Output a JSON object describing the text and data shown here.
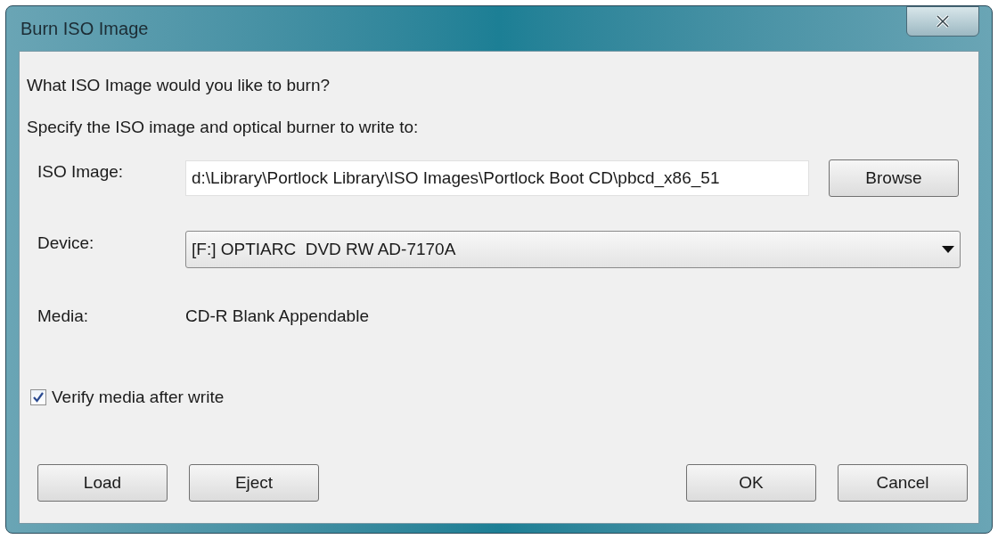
{
  "window": {
    "title": "Burn ISO Image"
  },
  "heading": "What ISO Image would you like to burn?",
  "instruction": "Specify the ISO image and optical burner to write to:",
  "iso_image": {
    "label": "ISO Image:",
    "value": "d:\\Library\\Portlock Library\\ISO Images\\Portlock Boot CD\\pbcd_x86_51",
    "browse": "Browse"
  },
  "device": {
    "label": "Device:",
    "value": "[F:] OPTIARC  DVD RW AD-7170A"
  },
  "media": {
    "label": "Media:",
    "value": "CD-R Blank Appendable"
  },
  "verify": {
    "label": "Verify media after write",
    "checked": true
  },
  "buttons_left": [
    "Load",
    "Eject"
  ],
  "buttons_right": [
    "OK",
    "Cancel"
  ]
}
